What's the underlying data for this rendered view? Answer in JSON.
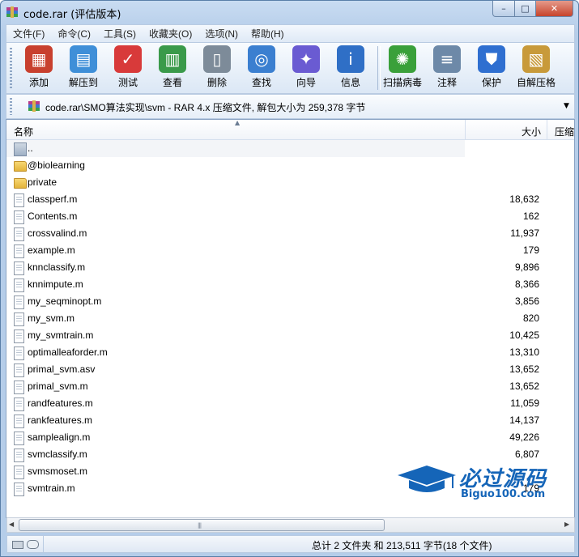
{
  "window": {
    "title": "code.rar (评估版本)",
    "buttons": {
      "minimize": "–",
      "maximize": "□",
      "close": "✕"
    }
  },
  "menu": [
    "文件(F)",
    "命令(C)",
    "工具(S)",
    "收藏夹(O)",
    "选项(N)",
    "帮助(H)"
  ],
  "toolbar": [
    {
      "label": "添加",
      "icon": "add-archive-icon",
      "color": "#c8402e"
    },
    {
      "label": "解压到",
      "icon": "extract-folder-icon",
      "color": "#3f8fd8"
    },
    {
      "label": "测试",
      "icon": "test-clipboard-icon",
      "color": "#d83a3a"
    },
    {
      "label": "查看",
      "icon": "view-book-icon",
      "color": "#3a9a4a"
    },
    {
      "label": "删除",
      "icon": "trash-icon",
      "color": "#7d8b99"
    },
    {
      "label": "查找",
      "icon": "magnifier-icon",
      "color": "#3b7fd0"
    },
    {
      "label": "向导",
      "icon": "wizard-wand-icon",
      "color": "#6a5bd2"
    },
    {
      "label": "信息",
      "icon": "info-icon",
      "color": "#2f6fc6"
    },
    {
      "label": "扫描病毒",
      "icon": "virus-scan-icon",
      "color": "#3aa03a"
    },
    {
      "label": "注释",
      "icon": "comment-icon",
      "color": "#6d89a8"
    },
    {
      "label": "保护",
      "icon": "shield-icon",
      "color": "#2f6fd0"
    },
    {
      "label": "自解压格",
      "icon": "sfx-box-icon",
      "color": "#c89a3a"
    }
  ],
  "address": {
    "text": "code.rar\\SMO算法实现\\svm - RAR 4.x 压缩文件, 解包大小为 259,378 字节"
  },
  "columns": {
    "name": "名称",
    "size": "大小",
    "packed": "压缩"
  },
  "files": [
    {
      "name": "..",
      "size": "",
      "type": "up"
    },
    {
      "name": "@biolearning",
      "size": "",
      "type": "folder"
    },
    {
      "name": "private",
      "size": "",
      "type": "folder"
    },
    {
      "name": "classperf.m",
      "size": "18,632",
      "type": "file"
    },
    {
      "name": "Contents.m",
      "size": "162",
      "type": "file"
    },
    {
      "name": "crossvalind.m",
      "size": "11,937",
      "type": "file"
    },
    {
      "name": "example.m",
      "size": "179",
      "type": "file"
    },
    {
      "name": "knnclassify.m",
      "size": "9,896",
      "type": "file"
    },
    {
      "name": "knnimpute.m",
      "size": "8,366",
      "type": "file"
    },
    {
      "name": "my_seqminopt.m",
      "size": "3,856",
      "type": "file"
    },
    {
      "name": "my_svm.m",
      "size": "820",
      "type": "file"
    },
    {
      "name": "my_svmtrain.m",
      "size": "10,425",
      "type": "file"
    },
    {
      "name": "optimalleaforder.m",
      "size": "13,310",
      "type": "file"
    },
    {
      "name": "primal_svm.asv",
      "size": "13,652",
      "type": "file"
    },
    {
      "name": "primal_svm.m",
      "size": "13,652",
      "type": "file"
    },
    {
      "name": "randfeatures.m",
      "size": "11,059",
      "type": "file"
    },
    {
      "name": "rankfeatures.m",
      "size": "14,137",
      "type": "file"
    },
    {
      "name": "samplealign.m",
      "size": "49,226",
      "type": "file"
    },
    {
      "name": "svmclassify.m",
      "size": "6,807",
      "type": "file"
    },
    {
      "name": "svmsmoset.m",
      "size": "",
      "type": "file"
    },
    {
      "name": "svmtrain.m",
      "size": "179",
      "type": "file"
    }
  ],
  "status": {
    "text": "总计 2 文件夹 和 213,511 字节(18 个文件)"
  },
  "watermark": {
    "text": "必过源码",
    "url": "Biguo100.com"
  }
}
